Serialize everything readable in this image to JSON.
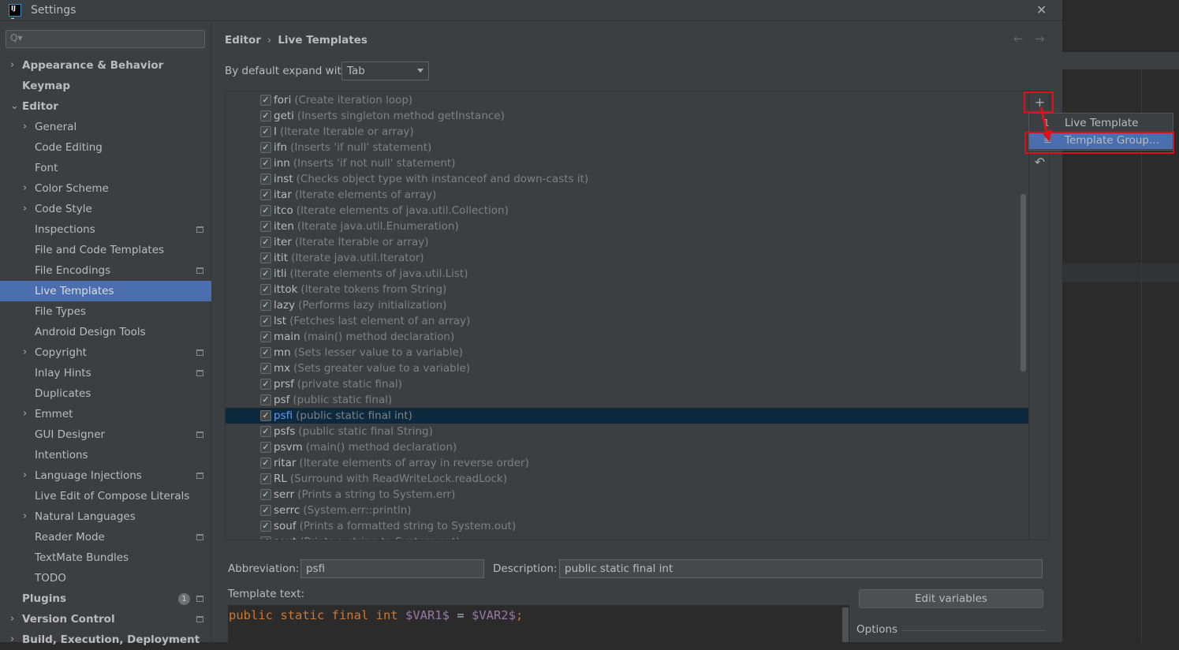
{
  "window": {
    "title": "Settings",
    "logo_text": "IJ"
  },
  "sidebar": {
    "search_placeholder": "Q▾",
    "items": [
      {
        "label": "Appearance & Behavior",
        "level": 0,
        "bold": true,
        "chevron": "right"
      },
      {
        "label": "Keymap",
        "level": 0,
        "bold": true
      },
      {
        "label": "Editor",
        "level": 0,
        "bold": true,
        "chevron": "down"
      },
      {
        "label": "General",
        "level": 1,
        "chevron": "right"
      },
      {
        "label": "Code Editing",
        "level": 1
      },
      {
        "label": "Font",
        "level": 1
      },
      {
        "label": "Color Scheme",
        "level": 1,
        "chevron": "right"
      },
      {
        "label": "Code Style",
        "level": 1,
        "chevron": "right"
      },
      {
        "label": "Inspections",
        "level": 1,
        "project": true
      },
      {
        "label": "File and Code Templates",
        "level": 1
      },
      {
        "label": "File Encodings",
        "level": 1,
        "project": true
      },
      {
        "label": "Live Templates",
        "level": 1,
        "selected": true
      },
      {
        "label": "File Types",
        "level": 1
      },
      {
        "label": "Android Design Tools",
        "level": 1
      },
      {
        "label": "Copyright",
        "level": 1,
        "chevron": "right",
        "project": true
      },
      {
        "label": "Inlay Hints",
        "level": 1,
        "project": true
      },
      {
        "label": "Duplicates",
        "level": 1
      },
      {
        "label": "Emmet",
        "level": 1,
        "chevron": "right"
      },
      {
        "label": "GUI Designer",
        "level": 1,
        "project": true
      },
      {
        "label": "Intentions",
        "level": 1
      },
      {
        "label": "Language Injections",
        "level": 1,
        "chevron": "right",
        "project": true
      },
      {
        "label": "Live Edit of Compose Literals",
        "level": 1
      },
      {
        "label": "Natural Languages",
        "level": 1,
        "chevron": "right"
      },
      {
        "label": "Reader Mode",
        "level": 1,
        "project": true
      },
      {
        "label": "TextMate Bundles",
        "level": 1
      },
      {
        "label": "TODO",
        "level": 1
      },
      {
        "label": "Plugins",
        "level": 0,
        "bold": true,
        "badge": "1",
        "project": true
      },
      {
        "label": "Version Control",
        "level": 0,
        "bold": true,
        "chevron": "right",
        "project": true
      },
      {
        "label": "Build, Execution, Deployment",
        "level": 0,
        "bold": true,
        "chevron": "right"
      }
    ]
  },
  "breadcrumb": {
    "parent": "Editor",
    "sep": "›",
    "current": "Live Templates"
  },
  "expand": {
    "label": "By default expand with",
    "value": "Tab"
  },
  "templates": [
    {
      "abbr": "fori",
      "desc": "(Create iteration loop)"
    },
    {
      "abbr": "geti",
      "desc": "(Inserts singleton method getInstance)"
    },
    {
      "abbr": "I",
      "desc": "(Iterate Iterable or array)"
    },
    {
      "abbr": "ifn",
      "desc": "(Inserts 'if null' statement)"
    },
    {
      "abbr": "inn",
      "desc": "(Inserts 'if not null' statement)"
    },
    {
      "abbr": "inst",
      "desc": "(Checks object type with instanceof and down-casts it)"
    },
    {
      "abbr": "itar",
      "desc": "(Iterate elements of array)"
    },
    {
      "abbr": "itco",
      "desc": "(Iterate elements of java.util.Collection)"
    },
    {
      "abbr": "iten",
      "desc": "(Iterate java.util.Enumeration)"
    },
    {
      "abbr": "iter",
      "desc": "(Iterate Iterable or array)"
    },
    {
      "abbr": "itit",
      "desc": "(Iterate java.util.Iterator)"
    },
    {
      "abbr": "itli",
      "desc": "(Iterate elements of java.util.List)"
    },
    {
      "abbr": "ittok",
      "desc": "(Iterate tokens from String)"
    },
    {
      "abbr": "lazy",
      "desc": "(Performs lazy initialization)"
    },
    {
      "abbr": "lst",
      "desc": "(Fetches last element of an array)"
    },
    {
      "abbr": "main",
      "desc": "(main() method declaration)"
    },
    {
      "abbr": "mn",
      "desc": "(Sets lesser value to a variable)"
    },
    {
      "abbr": "mx",
      "desc": "(Sets greater value to a variable)"
    },
    {
      "abbr": "prsf",
      "desc": "(private static final)"
    },
    {
      "abbr": "psf",
      "desc": "(public static final)"
    },
    {
      "abbr": "psfi",
      "desc": "(public static final int)",
      "selected": true
    },
    {
      "abbr": "psfs",
      "desc": "(public static final String)"
    },
    {
      "abbr": "psvm",
      "desc": "(main() method declaration)"
    },
    {
      "abbr": "ritar",
      "desc": "(Iterate elements of array in reverse order)"
    },
    {
      "abbr": "RL",
      "desc": "(Surround with ReadWriteLock.readLock)"
    },
    {
      "abbr": "serr",
      "desc": "(Prints a string to System.err)"
    },
    {
      "abbr": "serrc",
      "desc": "(System.err::println)"
    },
    {
      "abbr": "souf",
      "desc": "(Prints a formatted string to System.out)"
    },
    {
      "abbr": "sout",
      "desc": "(Prints a string to System.out)"
    }
  ],
  "popup": {
    "items": [
      {
        "label": "Live Template",
        "icon": "1"
      },
      {
        "label": "Template Group...",
        "icon": "≡",
        "selected": true
      }
    ]
  },
  "details": {
    "abbr_label": "Abbreviation:",
    "abbr_value": "psfi",
    "desc_label": "Description:",
    "desc_value": "public static final int",
    "template_label": "Template text:",
    "code": {
      "kw": "public static final int",
      "v1": "$VAR1$",
      "eq": " = ",
      "v2": "$VAR2$",
      "end": ";"
    },
    "edit_variables": "Edit variables",
    "options": "Options"
  },
  "colors": {
    "accent": "#4b6eaf",
    "selected_row": "#0d293e",
    "highlight_box": "#e0101a",
    "keyword": "#cc7832",
    "variable": "#9876aa"
  }
}
